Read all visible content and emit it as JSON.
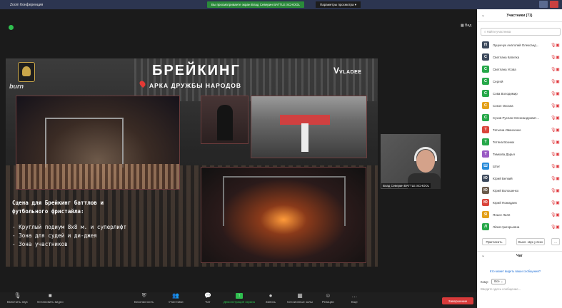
{
  "window": {
    "title": "Zoom Конференция",
    "share_banner": "Вы просматриваете экран Влад Северин BATTLE SCHOOL",
    "view_options": "Параметры просмотра ▾"
  },
  "main": {
    "view_label": "Вид",
    "speaker_name": "Влад Северин BATTLE SCHOOL"
  },
  "slide": {
    "title": "БРЕЙКИНГ",
    "subtitle": "АРКА ДРУЖБЫ НАРОДОВ",
    "brand_burn": "burn",
    "brand_vladee": "VLADEE",
    "desc_line1": "Сцена для Брейкинг баттлов и",
    "desc_line2": "футбольного фристайла:",
    "list": [
      "- Круглый подиум 8х8 м. и суперлифт",
      "- Зона для судей и ди-джея",
      "- Зона участников"
    ]
  },
  "toolbar": {
    "items": [
      {
        "label": "Включить звук",
        "icon": "mic-icon"
      },
      {
        "label": "Остановить видео",
        "icon": "video-icon"
      },
      {
        "label": "Безопасность",
        "icon": "security-icon"
      },
      {
        "label": "Участники",
        "icon": "participants-icon",
        "count": "71"
      },
      {
        "label": "Чат",
        "icon": "chat-icon"
      },
      {
        "label": "Демонстрация экрана",
        "icon": "share-screen-icon"
      },
      {
        "label": "Запись",
        "icon": "record-icon"
      },
      {
        "label": "Сессионные залы",
        "icon": "breakout-icon"
      },
      {
        "label": "Реакции",
        "icon": "reactions-icon"
      },
      {
        "label": "Еще",
        "icon": "more-icon"
      }
    ],
    "end_label": "Завершение"
  },
  "participants": {
    "header": "Участники (71)",
    "search_placeholder": "Найти участника",
    "list": [
      {
        "initial": "П",
        "name": "Луценчук Анатолий Олександ...",
        "color": "#3d4a5c"
      },
      {
        "initial": "С",
        "name": "Светлана Капитка",
        "color": "#3d4a5c"
      },
      {
        "initial": "С",
        "name": "Светлана Усова",
        "color": "#27a84a"
      },
      {
        "initial": "С",
        "name": "Сергей",
        "color": "#27a84a"
      },
      {
        "initial": "С",
        "name": "Сова Володимир",
        "color": "#27a84a"
      },
      {
        "initial": "С",
        "name": "Сокол Оксана",
        "color": "#e3a01a"
      },
      {
        "initial": "С",
        "name": "Сухов Руслан Олександрович...",
        "color": "#27a84a"
      },
      {
        "initial": "Т",
        "name": "Татьяна Иванченко",
        "color": "#d9443a"
      },
      {
        "initial": "Т",
        "name": "Тетяна Вознюк",
        "color": "#27a84a"
      },
      {
        "initial": "Т",
        "name": "Тимкова Дарья",
        "color": "#9a5bc4"
      },
      {
        "initial": "Ш",
        "name": "Штиг",
        "color": "#2a8bd9"
      },
      {
        "initial": "Ю",
        "name": "Юрий Белкий",
        "color": "#3d4a5c"
      },
      {
        "initial": "Ю",
        "name": "Юрий Волошенко",
        "color": "#6a5a4a"
      },
      {
        "initial": "Ю",
        "name": "Юрий Пожидаев",
        "color": "#d9443a"
      },
      {
        "initial": "Я",
        "name": "Яльне Лиля",
        "color": "#e3a01a"
      },
      {
        "initial": "Л",
        "name": "Лілия григорьевна",
        "color": "#27a84a"
      }
    ],
    "invite_label": "Пригласить",
    "mute_all_label": "Выкл. звук у всех",
    "more_label": "..."
  },
  "chat": {
    "header": "Чат",
    "note": "Кто может видеть ваши сообщения?",
    "to_label": "Кому:",
    "to_value": "Все",
    "input_placeholder": "Введите здесь сообщение..."
  }
}
